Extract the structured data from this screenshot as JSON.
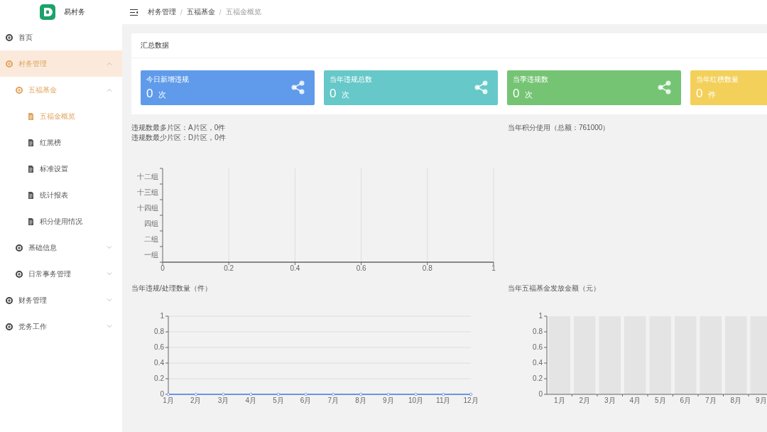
{
  "brand": {
    "name": "易村务"
  },
  "breadcrumb": [
    {
      "text": "村务管理",
      "kind": "link"
    },
    {
      "text": "/",
      "kind": "separator"
    },
    {
      "text": "五福基金",
      "kind": "link"
    },
    {
      "text": "/",
      "kind": "separator"
    },
    {
      "text": "五福金概览",
      "kind": "current"
    }
  ],
  "sidebar": {
    "items": [
      {
        "label": "首页",
        "selected": false
      },
      {
        "label": "村务管理",
        "selected": true,
        "expanded": true,
        "children": [
          {
            "label": "五福基金",
            "selected": true,
            "expanded": true,
            "children": [
              {
                "label": "五福金概览",
                "selected": true
              },
              {
                "label": "红黑榜",
                "selected": false
              },
              {
                "label": "标准设置",
                "selected": false
              },
              {
                "label": "统计报表",
                "selected": false
              },
              {
                "label": "积分使用情况",
                "selected": false
              }
            ]
          },
          {
            "label": "基础信息",
            "selected": false,
            "expanded": false
          },
          {
            "label": "日常事务管理",
            "selected": false,
            "expanded": false
          }
        ]
      },
      {
        "label": "财务管理",
        "selected": false,
        "expanded": false
      },
      {
        "label": "党务工作",
        "selected": false,
        "expanded": false
      }
    ]
  },
  "summary": {
    "title": "汇总数据",
    "cards": [
      {
        "title": "今日新增违规",
        "value": "0",
        "unit": "次",
        "color": "#5f9bea",
        "kind": "full"
      },
      {
        "title": "当年违规总数",
        "value": "0",
        "unit": "次",
        "color": "#66c8c8",
        "kind": "full"
      },
      {
        "title": "当季违规数",
        "value": "0",
        "unit": "次",
        "color": "#74c474",
        "kind": "full"
      },
      {
        "title": "当年红榜数量",
        "value": "0",
        "unit": "件",
        "color": "#f3d05a",
        "kind": "clipped"
      }
    ]
  },
  "stats": {
    "lines": [
      "违规数最多片区：A片区，0件",
      "违规数最少片区：D片区，0件"
    ],
    "chart_data": {
      "type": "bar",
      "orientation": "horizontal",
      "categories": [
        "十二组",
        "十三组",
        "十四组",
        "四组",
        "二组",
        "一组"
      ],
      "values": [
        0,
        0,
        0,
        0,
        0,
        0
      ],
      "xlim": [
        0,
        1
      ],
      "xticks": [
        0,
        0.2,
        0.4,
        0.6,
        0.8,
        1
      ],
      "grid": true
    }
  },
  "points_usage": {
    "title": "当年积分使用（总额：761000）"
  },
  "violations_chart": {
    "title": "当年违规/处理数量（件）",
    "chart_data": {
      "type": "line",
      "categories": [
        "1月",
        "2月",
        "3月",
        "4月",
        "5月",
        "6月",
        "7月",
        "8月",
        "9月",
        "10月",
        "11月",
        "12月"
      ],
      "values": [
        0,
        0,
        0,
        0,
        0,
        0,
        0,
        0,
        0,
        0,
        0,
        0
      ],
      "ylim": [
        0,
        1
      ],
      "yticks": [
        0,
        0.2,
        0.4,
        0.6,
        0.8,
        1
      ],
      "grid": true,
      "marker": true
    }
  },
  "fund_chart": {
    "title": "当年五福基金发放金额（元）",
    "chart_data": {
      "type": "bar",
      "categories": [
        "1月",
        "2月",
        "3月",
        "4月",
        "5月",
        "6月",
        "7月",
        "8月",
        "9月"
      ],
      "values": [
        0,
        0,
        0,
        0,
        0,
        0,
        0,
        0,
        0
      ],
      "ylim": [
        0,
        1
      ],
      "yticks": [
        0,
        0.2,
        0.4,
        0.6,
        0.8,
        1
      ]
    }
  }
}
